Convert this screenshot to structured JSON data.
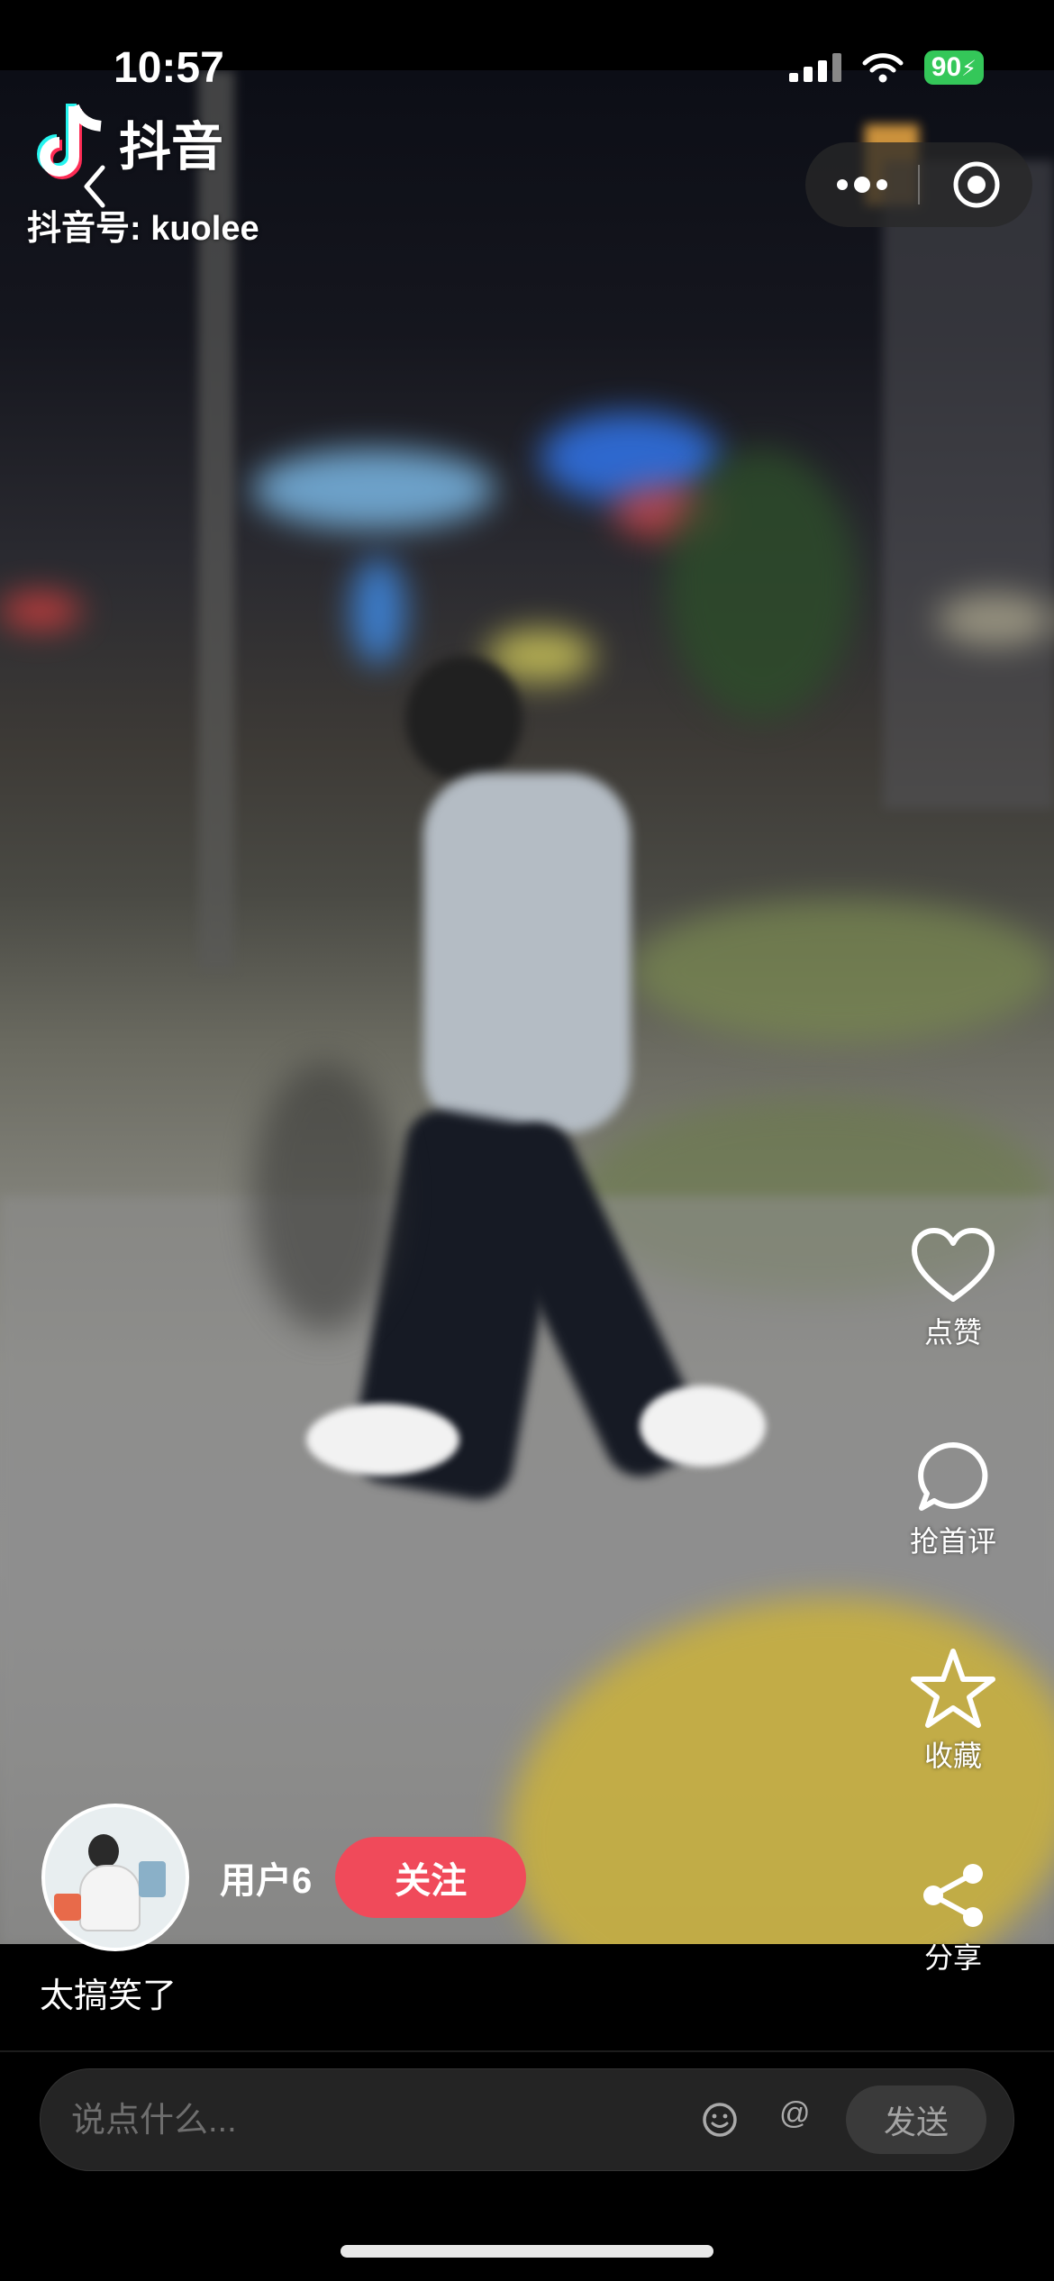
{
  "status_bar": {
    "time": "10:57",
    "battery": "90"
  },
  "header": {
    "app_name": "抖音",
    "account_id": "抖音号: kuolee"
  },
  "side_actions": {
    "like": "点赞",
    "comment": "抢首评",
    "favorite": "收藏",
    "share": "分享"
  },
  "author": {
    "username": "用户6",
    "follow_label": "关注"
  },
  "caption": "太搞笑了",
  "comment_bar": {
    "placeholder": "说点什么...",
    "at_symbol": "@",
    "send_label": "发送"
  },
  "colors": {
    "follow": "#f04a5a",
    "battery": "#34c759"
  }
}
